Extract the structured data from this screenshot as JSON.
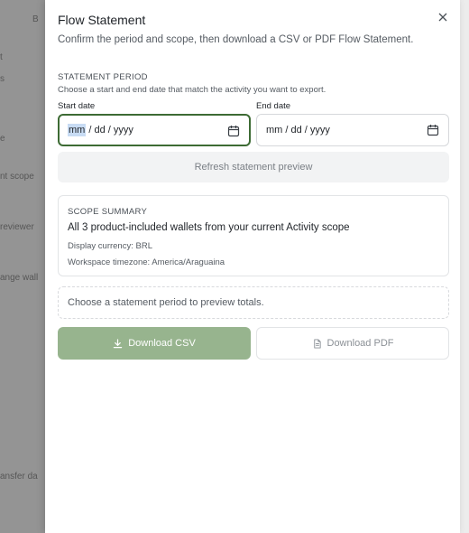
{
  "drawer": {
    "title": "Flow Statement",
    "subtitle": "Confirm the period and scope, then download a CSV or PDF Flow Statement."
  },
  "period": {
    "section_label": "STATEMENT PERIOD",
    "description": "Choose a start and end date that match the activity you want to export.",
    "start": {
      "label": "Start date",
      "mm": "mm",
      "rest": " / dd / yyyy"
    },
    "end": {
      "label": "End date",
      "value": "mm / dd / yyyy"
    },
    "refresh_label": "Refresh statement preview"
  },
  "scope": {
    "section_label": "SCOPE SUMMARY",
    "summary": "All 3 product-included wallets from your current Activity scope",
    "currency": "Display currency: BRL",
    "timezone": "Workspace timezone: America/Araguaina"
  },
  "preview": {
    "message": "Choose a statement period to preview totals."
  },
  "actions": {
    "csv_label": "Download CSV",
    "pdf_label": "Download PDF"
  },
  "colors": {
    "accent": "#3d6b34",
    "csv_button": "#97b48e"
  }
}
